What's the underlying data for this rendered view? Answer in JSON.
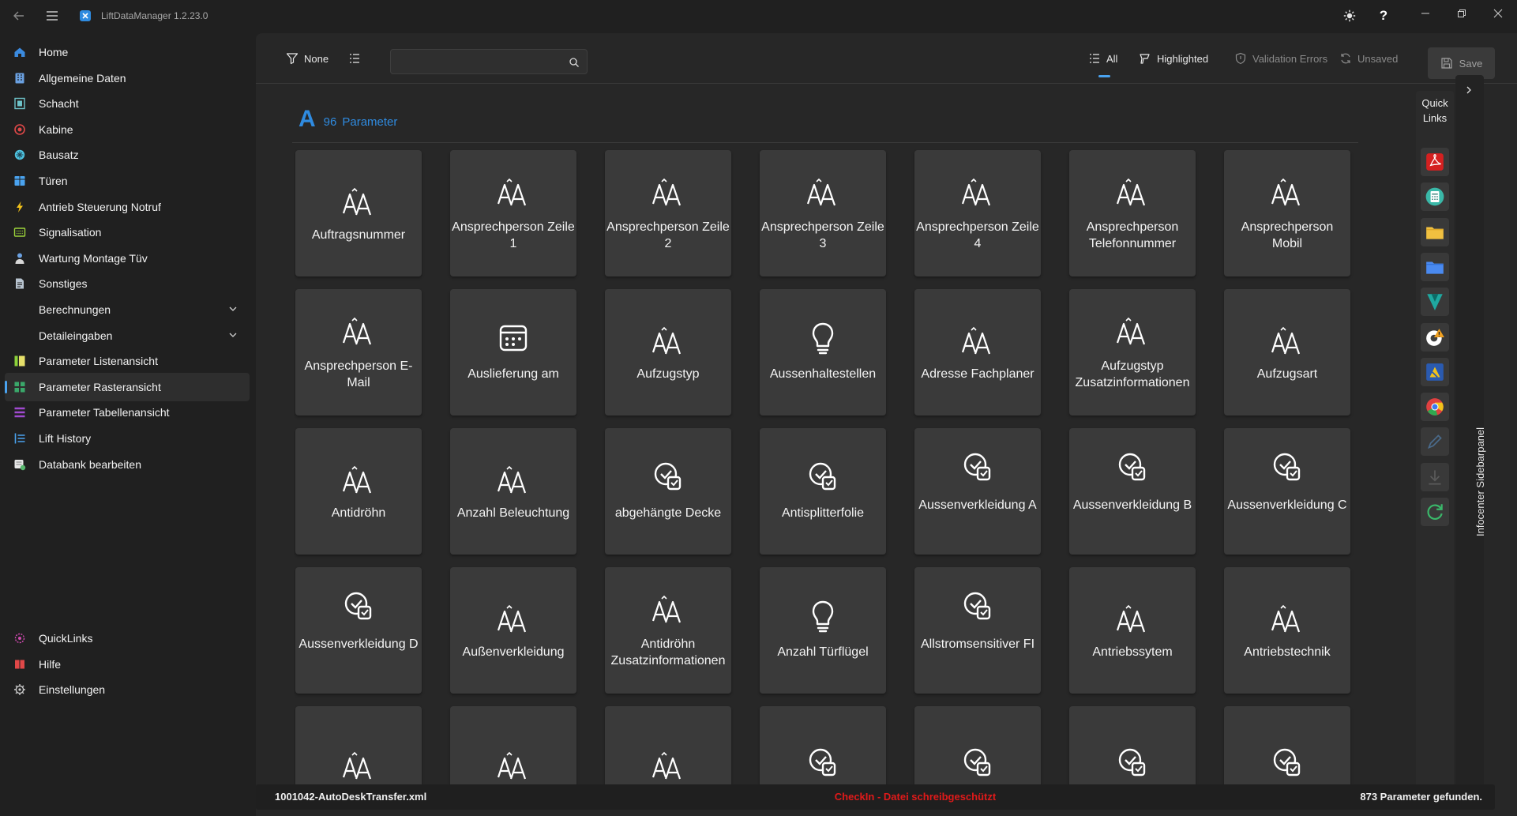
{
  "app": {
    "title": "LiftDataManager 1.2.23.0",
    "icons": {
      "back": "back-arrow-icon",
      "menu": "hamburger-icon",
      "logo": "app-logo-icon",
      "theme": "sun-icon",
      "help": "question-mark-icon"
    }
  },
  "sidebar": {
    "items": [
      {
        "label": "Home",
        "icon": "home-icon",
        "color": "#3b8be0"
      },
      {
        "label": "Allgemeine Daten",
        "icon": "building-icon",
        "color": "#6aa0e0"
      },
      {
        "label": "Schacht",
        "icon": "shaft-icon",
        "color": "#6ec3c9"
      },
      {
        "label": "Kabine",
        "icon": "cabin-icon",
        "color": "#e04848"
      },
      {
        "label": "Bausatz",
        "icon": "kit-icon",
        "color": "#4ec3e0"
      },
      {
        "label": "Türen",
        "icon": "door-icon",
        "color": "#4aa3f0"
      },
      {
        "label": "Antrieb Steuerung Notruf",
        "icon": "lightning-icon",
        "color": "#f2c21a"
      },
      {
        "label": "Signalisation",
        "icon": "display-icon",
        "color": "#9cd23a"
      },
      {
        "label": "Wartung Montage Tüv",
        "icon": "worker-icon",
        "color": "#6aa0e0"
      },
      {
        "label": "Sonstiges",
        "icon": "document-icon",
        "color": "#b8c4d0"
      },
      {
        "label": "Berechnungen",
        "icon": "",
        "color": ""
      },
      {
        "label": "Detaileingaben",
        "icon": "",
        "color": ""
      },
      {
        "label": "Parameter Listenansicht",
        "icon": "list-view-icon",
        "color": "#8cd23a"
      },
      {
        "label": "Parameter Rasteransicht",
        "icon": "grid-view-icon",
        "color": "#3aa86a"
      },
      {
        "label": "Parameter Tabellenansicht",
        "icon": "table-view-icon",
        "color": "#a04ad0"
      },
      {
        "label": "Lift History",
        "icon": "history-icon",
        "color": "#4aa3f0"
      },
      {
        "label": "Databank bearbeiten",
        "icon": "database-edit-icon",
        "color": "#5ab870"
      }
    ],
    "bottom": [
      {
        "label": "QuickLinks",
        "icon": "quicklinks-icon",
        "color": "#d04ab0"
      },
      {
        "label": "Hilfe",
        "icon": "help-book-icon",
        "color": "#e04848"
      },
      {
        "label": "Einstellungen",
        "icon": "gear-icon",
        "color": "#c8c8c8"
      }
    ],
    "active": "Parameter Rasteransicht"
  },
  "toolbar": {
    "filter_label": "None",
    "search_placeholder": "",
    "all_label": "All",
    "highlighted_label": "Highlighted",
    "validation_label": "Validation Errors",
    "unsaved_label": "Unsaved",
    "save_label": "Save"
  },
  "group": {
    "letter": "A",
    "count": "96",
    "label": "Parameter"
  },
  "tiles": [
    {
      "label": "Auftragsnummer",
      "icon": "text-aa-icon"
    },
    {
      "label": "Ansprechperson Zeile 1",
      "icon": "text-aa-icon"
    },
    {
      "label": "Ansprechperson Zeile 2",
      "icon": "text-aa-icon"
    },
    {
      "label": "Ansprechperson Zeile 3",
      "icon": "text-aa-icon"
    },
    {
      "label": "Ansprechperson Zeile 4",
      "icon": "text-aa-icon"
    },
    {
      "label": "Ansprechperson Telefonnummer",
      "icon": "text-aa-icon"
    },
    {
      "label": "Ansprechperson Mobil",
      "icon": "text-aa-icon"
    },
    {
      "label": "Ansprechperson E-Mail",
      "icon": "text-aa-icon"
    },
    {
      "label": "Auslieferung am",
      "icon": "calendar-icon"
    },
    {
      "label": "Aufzugstyp",
      "icon": "text-aa-icon"
    },
    {
      "label": "Aussenhaltestellen",
      "icon": "lightbulb-icon"
    },
    {
      "label": "Adresse Fachplaner",
      "icon": "text-aa-icon"
    },
    {
      "label": "Aufzugstyp Zusatzinformationen",
      "icon": "text-aa-icon"
    },
    {
      "label": "Aufzugsart",
      "icon": "text-aa-icon"
    },
    {
      "label": "Antidröhn",
      "icon": "text-aa-icon"
    },
    {
      "label": "Anzahl Beleuchtung",
      "icon": "text-aa-icon"
    },
    {
      "label": "abgehängte Decke",
      "icon": "checkbox-icon"
    },
    {
      "label": "Antisplitterfolie",
      "icon": "checkbox-icon"
    },
    {
      "label": "Aussenverkleidung A",
      "icon": "checkbox-icon"
    },
    {
      "label": "Aussenverkleidung B",
      "icon": "checkbox-icon"
    },
    {
      "label": "Aussenverkleidung C",
      "icon": "checkbox-icon"
    },
    {
      "label": "Aussenverkleidung D",
      "icon": "checkbox-icon"
    },
    {
      "label": "Außenverkleidung",
      "icon": "text-aa-icon"
    },
    {
      "label": "Antidröhn Zusatzinformationen",
      "icon": "text-aa-icon"
    },
    {
      "label": "Anzahl Türflügel",
      "icon": "lightbulb-icon"
    },
    {
      "label": "Allstromsensitiver FI",
      "icon": "checkbox-icon"
    },
    {
      "label": "Antriebssytem",
      "icon": "text-aa-icon"
    },
    {
      "label": "Antriebstechnik",
      "icon": "text-aa-icon"
    },
    {
      "label": "",
      "icon": "text-aa-icon"
    },
    {
      "label": "",
      "icon": "text-aa-icon"
    },
    {
      "label": "",
      "icon": "text-aa-icon"
    },
    {
      "label": "",
      "icon": "checkbox-icon"
    },
    {
      "label": "",
      "icon": "checkbox-icon"
    },
    {
      "label": "",
      "icon": "checkbox-icon"
    },
    {
      "label": "",
      "icon": "checkbox-icon"
    }
  ],
  "quicklinks": {
    "title": "Quick Links",
    "items": [
      {
        "name": "pdf-icon",
        "color": "#d42020"
      },
      {
        "name": "calculator-icon",
        "color": "#3ab8a8"
      },
      {
        "name": "folder-icon",
        "color": "#f0c040"
      },
      {
        "name": "blue-folder-icon",
        "color": "#4a8af0"
      },
      {
        "name": "vault-icon",
        "color": "#1fa8a0"
      },
      {
        "name": "cad-warning-icon",
        "color": "#f0a020"
      },
      {
        "name": "crane-app-icon",
        "color": "#2a5ab0"
      },
      {
        "name": "chrome-icon",
        "color": "#e04040"
      },
      {
        "name": "pen-icon",
        "color": "#4a6a8a"
      },
      {
        "name": "download-icon",
        "color": "#5a5a5a"
      },
      {
        "name": "refresh-icon",
        "color": "#3ab86a"
      }
    ]
  },
  "infopanel": {
    "label": "Infocenter Sidebarpanel"
  },
  "status": {
    "file": "1001042-AutoDeskTransfer.xml",
    "warning": "CheckIn - Datei schreibgeschützt",
    "count_text": "873 Parameter gefunden."
  }
}
